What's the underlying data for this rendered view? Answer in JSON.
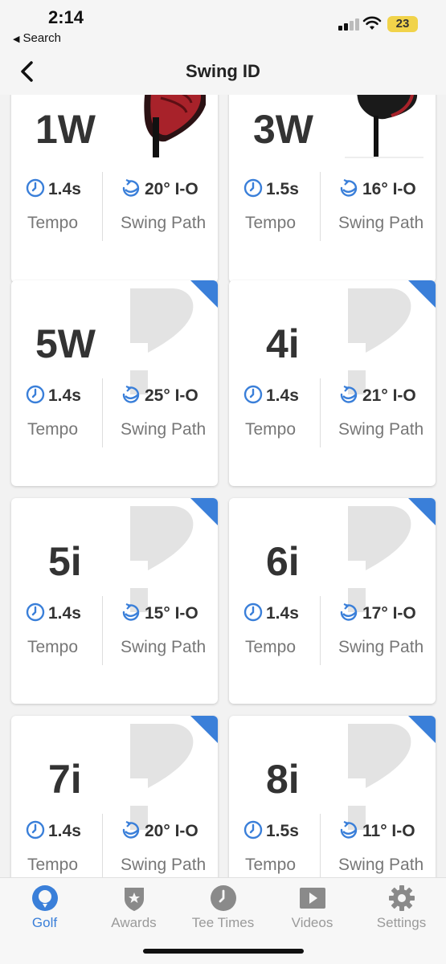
{
  "status_bar": {
    "time": "2:14",
    "back_app": "Search",
    "battery": "23"
  },
  "header": {
    "title": "Swing ID"
  },
  "colors": {
    "accent": "#3a7fd9",
    "text": "#333333",
    "muted": "#777777"
  },
  "clubs": [
    {
      "name": "1W",
      "tempo": "1.4s",
      "path": "20° I-O",
      "tempo_label": "Tempo",
      "path_label": "Swing Path",
      "image": "driver-photo",
      "badge": false
    },
    {
      "name": "3W",
      "tempo": "1.5s",
      "path": "16° I-O",
      "tempo_label": "Tempo",
      "path_label": "Swing Path",
      "image": "fairway-wood-photo",
      "badge": false
    },
    {
      "name": "5W",
      "tempo": "1.4s",
      "path": "25° I-O",
      "tempo_label": "Tempo",
      "path_label": "Swing Path",
      "image": "question-mark",
      "badge": true
    },
    {
      "name": "4i",
      "tempo": "1.4s",
      "path": "21° I-O",
      "tempo_label": "Tempo",
      "path_label": "Swing Path",
      "image": "question-mark",
      "badge": true
    },
    {
      "name": "5i",
      "tempo": "1.4s",
      "path": "15° I-O",
      "tempo_label": "Tempo",
      "path_label": "Swing Path",
      "image": "question-mark",
      "badge": true
    },
    {
      "name": "6i",
      "tempo": "1.4s",
      "path": "17° I-O",
      "tempo_label": "Tempo",
      "path_label": "Swing Path",
      "image": "question-mark",
      "badge": true
    },
    {
      "name": "7i",
      "tempo": "1.4s",
      "path": "20° I-O",
      "tempo_label": "Tempo",
      "path_label": "Swing Path",
      "image": "question-mark",
      "badge": true
    },
    {
      "name": "8i",
      "tempo": "1.5s",
      "path": "11° I-O",
      "tempo_label": "Tempo",
      "path_label": "Swing Path",
      "image": "question-mark",
      "badge": true
    }
  ],
  "tabs": [
    {
      "label": "Golf",
      "icon": "golf-ball-icon",
      "active": true
    },
    {
      "label": "Awards",
      "icon": "shield-star-icon",
      "active": false
    },
    {
      "label": "Tee Times",
      "icon": "clock-icon",
      "active": false
    },
    {
      "label": "Videos",
      "icon": "video-play-icon",
      "active": false
    },
    {
      "label": "Settings",
      "icon": "gear-icon",
      "active": false
    }
  ]
}
